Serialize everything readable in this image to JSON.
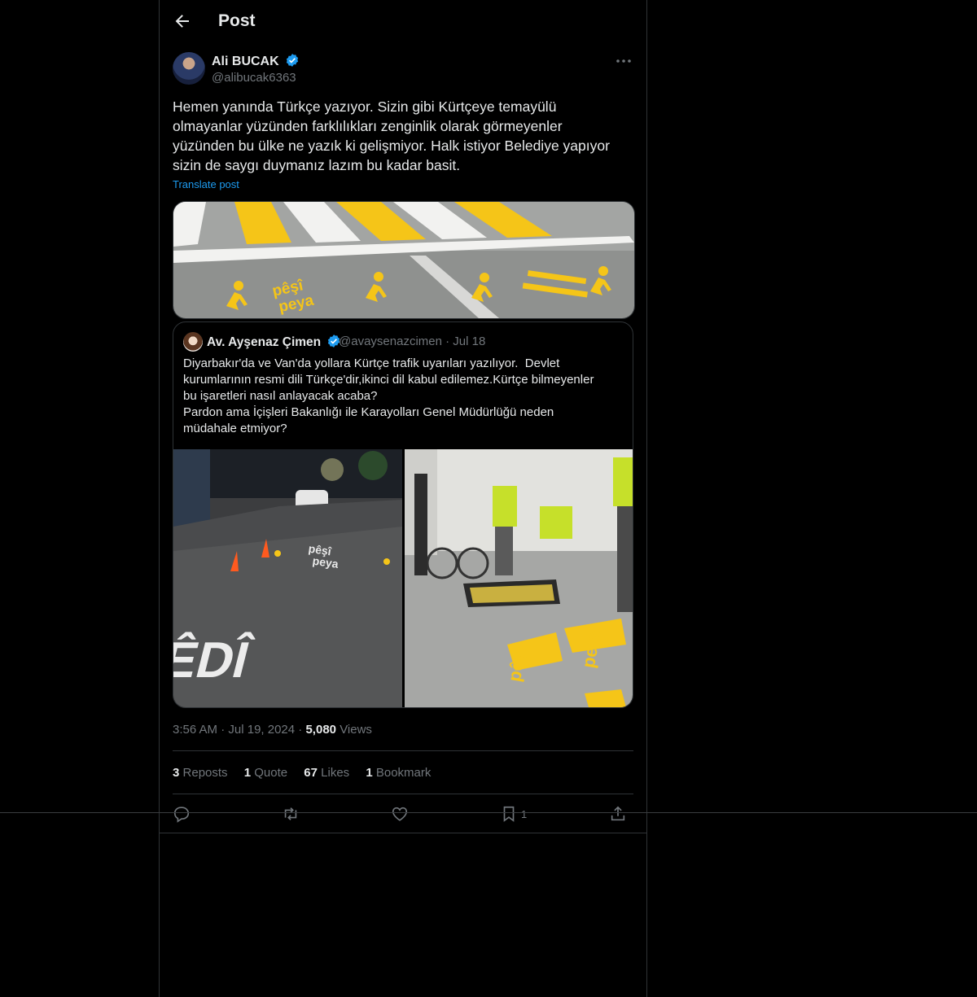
{
  "header": {
    "title": "Post"
  },
  "author": {
    "name": "Ali BUCAK",
    "handle": "@alibucak6363"
  },
  "tweet": {
    "text": "Hemen yanında Türkçe yazıyor. Sizin gibi Kürtçeye temayülü\nolmayanlar yüzünden farklılıkları zenginlik olarak görmeyenler\nyüzünden bu ülke ne yazık ki gelişmiyor. Halk istiyor Belediye yapıyor\nsizin de saygı duymanız lazım bu kadar basit.",
    "translate_label": "Translate post",
    "time": "3:56 AM",
    "date": "Jul 19, 2024",
    "views_count": "5,080",
    "views_label": "Views"
  },
  "main_image": {
    "text_left_line1": "pêşî",
    "text_left_line2": "peya"
  },
  "quote": {
    "name": "Av. Ayşenaz Çimen",
    "handle": "@avaysenazcimen",
    "date": "Jul 18",
    "text": "Diyarbakır'da ve Van'da yollara Kürtçe trafik uyarıları yazılıyor.  Devlet\nkurumlarının resmi dili Türkçe'dir,ikinci dil kabul edilemez.Kürtçe bilmeyenler\nbu işaretleri nasıl anlayacak acaba?\nPardon ama İçişleri Bakanlığı ile Karayolları Genel Müdürlüğü neden\nmüdahale etmiyor?",
    "img_left_big_text": "HÊDÎ",
    "img_left_line1": "pêşî",
    "img_left_line2": "peya",
    "img_right_line1": "pêşî",
    "img_right_line2": "peya"
  },
  "stats": {
    "reposts_count": "3",
    "reposts_label": "Reposts",
    "quotes_count": "1",
    "quotes_label": "Quote",
    "likes_count": "67",
    "likes_label": "Likes",
    "bookmarks_count": "1",
    "bookmarks_label": "Bookmark"
  },
  "actions": {
    "bookmark_count": "1"
  },
  "icons": {
    "back": "arrow-left-icon",
    "verified": "verified-badge-icon",
    "more": "more-horizontal-icon",
    "reply": "reply-icon",
    "repost": "repost-icon",
    "like": "heart-icon",
    "bookmark": "bookmark-icon",
    "share": "share-icon"
  },
  "colors": {
    "accent": "#1d9bf0",
    "background": "#000000",
    "muted": "#71767b",
    "marking_yellow": "#f5c518"
  }
}
